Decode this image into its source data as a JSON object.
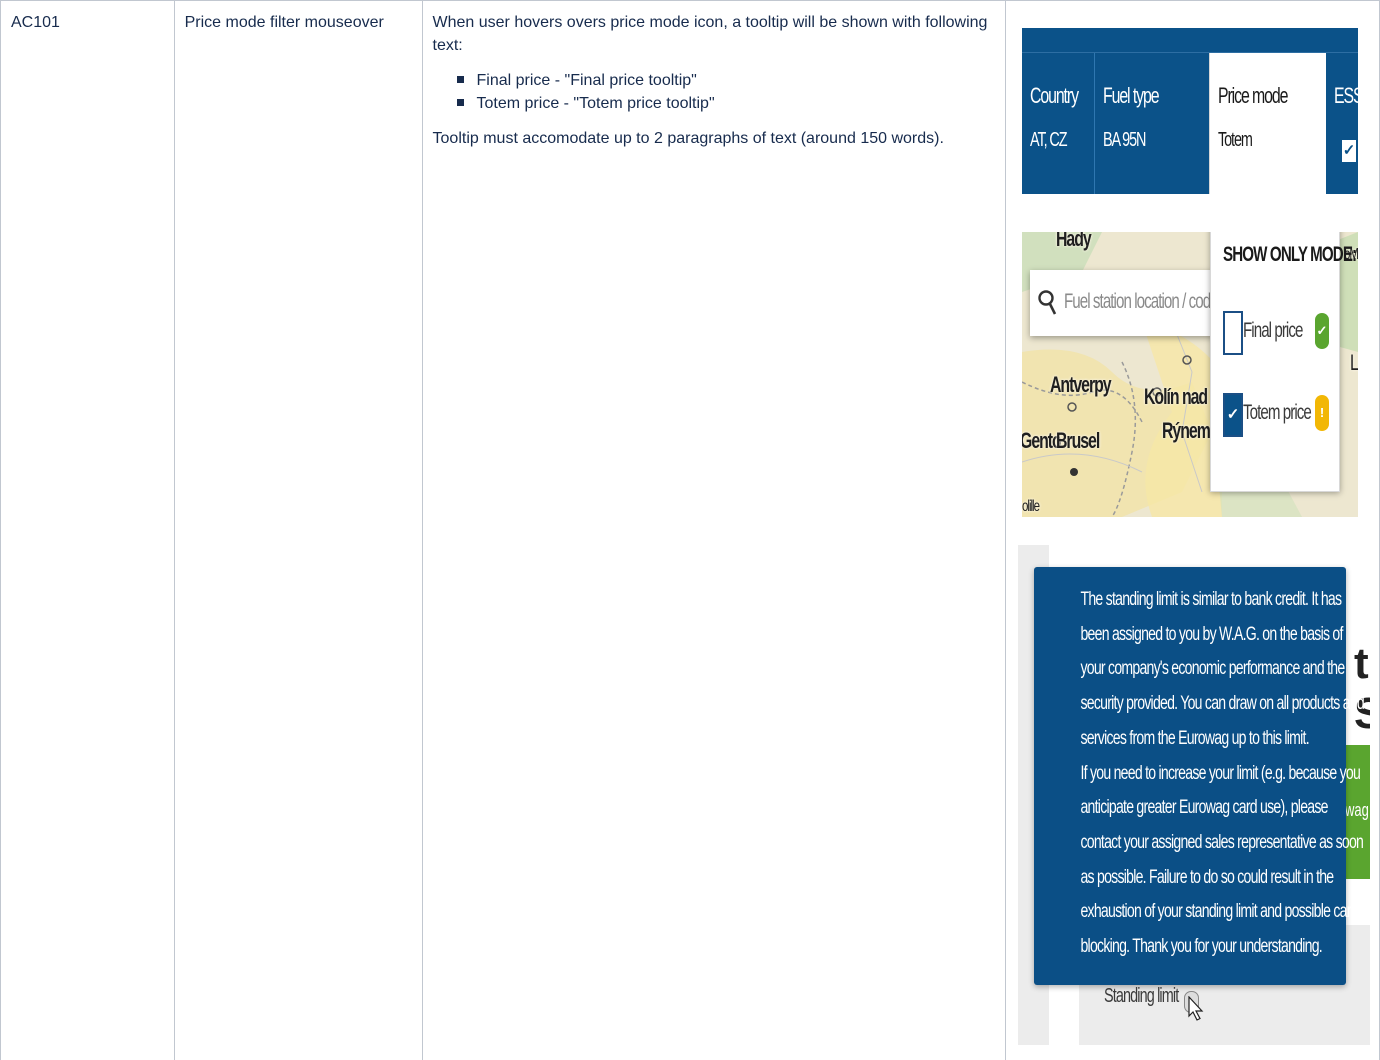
{
  "row": {
    "id": "AC101",
    "name": "Price mode filter mouseover",
    "description": {
      "intro": "When user hovers overs price mode icon, a tooltip will be shown with following text:",
      "bullets": [
        "Final price - \"Final price tooltip\"",
        "Totem price - \"Totem price tooltip\""
      ],
      "note": "Tooltip must accomodate up to 2 paragraphs of text (around 150 words)."
    }
  },
  "screenshot_header": {
    "columns": [
      {
        "label": "Country",
        "value": "AT, CZ"
      },
      {
        "label": "Fuel type",
        "value": "BA 95N"
      },
      {
        "label": "Price mode",
        "value": "Totem"
      },
      {
        "label": "ESS",
        "value": "✓"
      }
    ]
  },
  "screenshot_map": {
    "search_placeholder": "Fuel station location / code",
    "map_labels": [
      "Antverpy",
      "Kolín nad",
      "Rýnem",
      "Gento",
      "Brusel",
      "Hady",
      "oMa",
      "Li",
      "olille"
    ],
    "dropdown": {
      "title": "SHOW ONLY MODE:",
      "options": [
        {
          "label": "Final price",
          "checked": false,
          "status_color": "#5aa52f",
          "status_icon": "check-icon"
        },
        {
          "label": "Totem price",
          "checked": true,
          "status_color": "#f2b705",
          "status_icon": "exclamation-icon"
        }
      ]
    }
  },
  "screenshot_tooltip": {
    "lines": [
      "The standing limit is similar to bank credit. It has",
      "been assigned to you by W.A.G. on the basis of",
      "your company's economic performance and the",
      "security provided. You can draw on all products and",
      "services from the Eurowag up to this limit.",
      "If you need to increase your limit (e.g. because you",
      "anticipate greater Eurowag card use), please",
      "contact your assigned sales representative as soon",
      "as possible. Failure to do so could result in the",
      "exhaustion of your standing limit and possible card",
      "blocking. Thank you for your understanding."
    ],
    "label": "Standing limit",
    "partial_heading": "t S",
    "partial_button_text": "wag",
    "colors": {
      "tooltip_bg": "#0b4f86",
      "button_green": "#5aa52f"
    }
  },
  "colors": {
    "header_blue": "#0b5289",
    "border": "#c1c7d0",
    "text": "#172b4d"
  }
}
